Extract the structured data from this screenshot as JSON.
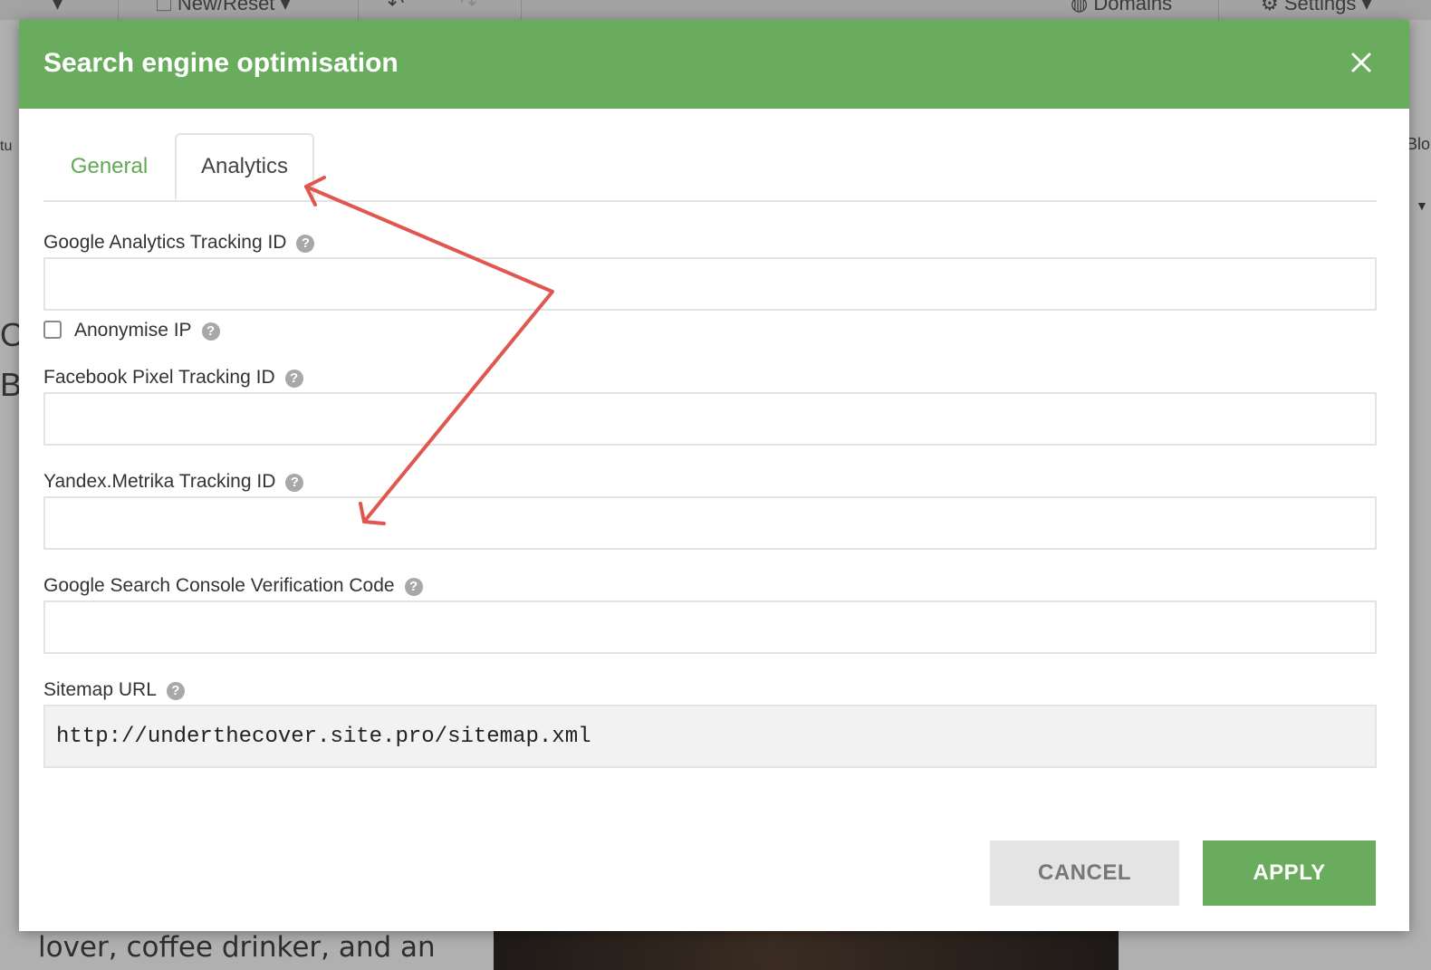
{
  "background": {
    "toolbar": {
      "new_reset": "New/Reset",
      "domains": "Domains",
      "settings": "Settings"
    },
    "left_fragments": [
      "tu",
      "O",
      "B"
    ],
    "right_fragments": [
      "Blo"
    ],
    "page_text": "lover, coffee drinker, and an"
  },
  "modal": {
    "title": "Search engine optimisation",
    "tabs": [
      {
        "label": "General",
        "active": false
      },
      {
        "label": "Analytics",
        "active": true
      }
    ],
    "fields": {
      "google_analytics": {
        "label": "Google Analytics Tracking ID",
        "value": ""
      },
      "anonymise_ip": {
        "label": "Anonymise IP",
        "checked": false
      },
      "facebook_pixel": {
        "label": "Facebook Pixel Tracking ID",
        "value": ""
      },
      "yandex_metrika": {
        "label": "Yandex.Metrika Tracking ID",
        "value": ""
      },
      "google_search_console": {
        "label": "Google Search Console Verification Code",
        "value": ""
      },
      "sitemap_url": {
        "label": "Sitemap URL",
        "value": "http://underthecover.site.pro/sitemap.xml"
      }
    },
    "help_glyph": "?",
    "buttons": {
      "cancel": "CANCEL",
      "apply": "APPLY"
    }
  },
  "colors": {
    "header_green": "#6aac5d",
    "tab_green": "#5faa52",
    "annotation_red": "#e0574f"
  }
}
